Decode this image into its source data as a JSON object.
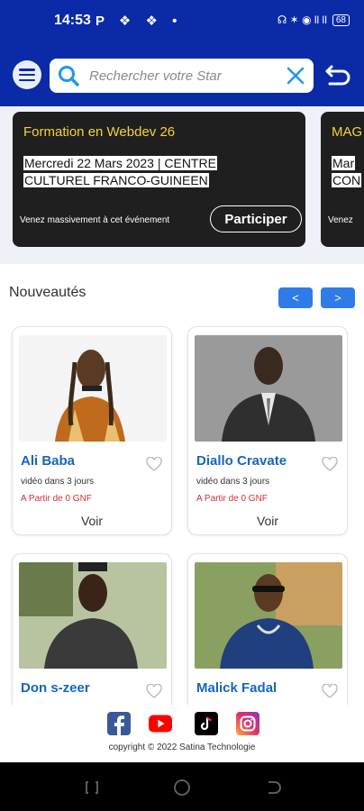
{
  "status_bar": {
    "time": "14:53",
    "left_icons": "P ❖ ❖ •",
    "right_icons": "☊ ✶ ◉ ll ll",
    "battery": "68"
  },
  "header": {
    "search_placeholder": "Rechercher votre Star",
    "icons": [
      "menu-icon",
      "search-icon",
      "close-icon",
      "back-icon"
    ],
    "accent_color": "#0a2aa8"
  },
  "events": [
    {
      "title": "Formation en Webdev 26",
      "date": "Mercredi 22 Mars 2023 | CENTRE CULTUREL FRANCO-GUINEEN",
      "description": "Venez massivement à cet événement",
      "cta": "Participer"
    },
    {
      "title": "MAG",
      "date": "Mar CON",
      "description": "Venez",
      "cta": ""
    }
  ],
  "section": {
    "title": "Nouveautés",
    "prev": "<",
    "next": ">"
  },
  "stars": [
    {
      "name": "Ali Baba",
      "availability": "vidéo dans 3 jours",
      "price": "A Partir de  0 GNF",
      "cta": "Voir"
    },
    {
      "name": "Diallo Cravate",
      "availability": "vidéo dans 3 jours",
      "price": "A Partir de  0 GNF",
      "cta": "Voir"
    },
    {
      "name": "Don s-zeer",
      "availability": "",
      "price": "",
      "cta": ""
    },
    {
      "name": "Malick Fadal",
      "availability": "",
      "price": "",
      "cta": ""
    }
  ],
  "footer": {
    "social_icons": [
      "facebook-icon",
      "youtube-icon",
      "tiktok-icon",
      "instagram-icon"
    ],
    "copyright": "copyright © 2022 Satina Technologie"
  }
}
